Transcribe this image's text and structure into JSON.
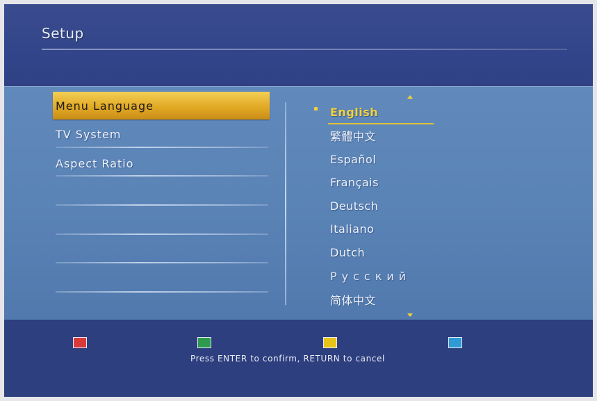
{
  "header": {
    "title": "Setup"
  },
  "menu": {
    "items": [
      {
        "label": "Menu Language",
        "selected": true
      },
      {
        "label": "TV System",
        "selected": false
      },
      {
        "label": "Aspect Ratio",
        "selected": false
      },
      {
        "label": "",
        "selected": false
      },
      {
        "label": "",
        "selected": false
      },
      {
        "label": "",
        "selected": false
      },
      {
        "label": "",
        "selected": false
      }
    ]
  },
  "languages": {
    "selected_index": 0,
    "options": [
      "English",
      "繁體中文",
      "Español",
      "Français",
      "Deutsch",
      "Italiano",
      "Dutch",
      "Русский",
      "简体中文"
    ],
    "scroll_up_icon": "arrow-up-icon",
    "scroll_down_icon": "arrow-down-icon"
  },
  "footer": {
    "keys": [
      {
        "name": "red",
        "color": "#d83a3a"
      },
      {
        "name": "green",
        "color": "#2d9a4e"
      },
      {
        "name": "yellow",
        "color": "#e8c418"
      },
      {
        "name": "blue",
        "color": "#2f9ad6"
      }
    ],
    "hint": "Press ENTER to confirm, RETURN to cancel"
  },
  "colors": {
    "accent_gold": "#e2a924",
    "highlight_text": "#f1d03c",
    "background_blue": "#2d3e7e",
    "panel_blue": "#5a83b6"
  }
}
